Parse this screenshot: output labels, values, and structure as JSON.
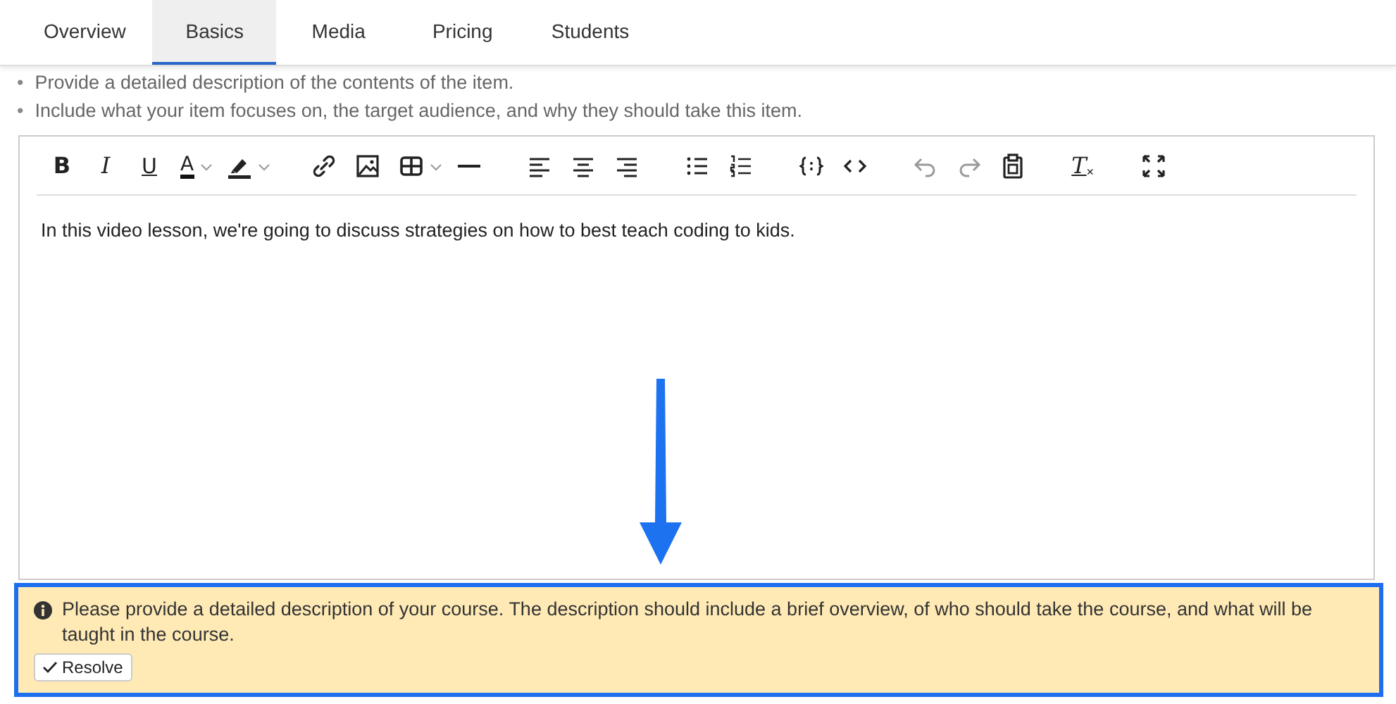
{
  "tabs": [
    {
      "label": "Overview",
      "selected": false
    },
    {
      "label": "Basics",
      "selected": true
    },
    {
      "label": "Media",
      "selected": false
    },
    {
      "label": "Pricing",
      "selected": false
    },
    {
      "label": "Students",
      "selected": false
    }
  ],
  "hints": [
    {
      "bullet": "•",
      "text": "Provide a detailed description of the contents of the item."
    },
    {
      "bullet": "•",
      "text": "Include what your item focuses on, the target audience, and why they should take this item."
    }
  ],
  "toolbar": [
    [
      {
        "kind": "bold",
        "glyph": "B",
        "disabled": false
      },
      {
        "kind": "italic",
        "glyph": "I",
        "disabled": false
      },
      {
        "kind": "underline",
        "glyph": "U",
        "disabled": false
      },
      {
        "kind": "text-color",
        "glyph": "A",
        "disabled": false
      },
      {
        "kind": "highlight",
        "disabled": false
      }
    ],
    [
      {
        "kind": "link",
        "disabled": false
      },
      {
        "kind": "image",
        "disabled": false
      },
      {
        "kind": "table",
        "disabled": false
      },
      {
        "kind": "rule",
        "disabled": false
      }
    ],
    [
      {
        "kind": "align-left",
        "disabled": false
      },
      {
        "kind": "align-center",
        "disabled": false
      },
      {
        "kind": "align-right",
        "disabled": false
      }
    ],
    [
      {
        "kind": "bullet-list",
        "disabled": false
      },
      {
        "kind": "numbered-list",
        "disabled": false
      }
    ],
    [
      {
        "kind": "code-block",
        "disabled": false
      },
      {
        "kind": "source",
        "disabled": false
      }
    ],
    [
      {
        "kind": "undo",
        "disabled": true
      },
      {
        "kind": "redo",
        "disabled": true
      },
      {
        "kind": "paste",
        "disabled": false
      }
    ],
    [
      {
        "kind": "clear-format",
        "glyph": "T",
        "subscript": "×",
        "disabled": false
      }
    ],
    [
      {
        "kind": "fullscreen",
        "disabled": false
      }
    ]
  ],
  "editor": {
    "content": "In this video lesson, we're going to discuss strategies on how to best teach coding to kids."
  },
  "alert": {
    "message": "Please provide a detailed description of your course. The description should include a brief overview, of who should take the course, and what will be taught in the course.",
    "button": "Resolve"
  }
}
